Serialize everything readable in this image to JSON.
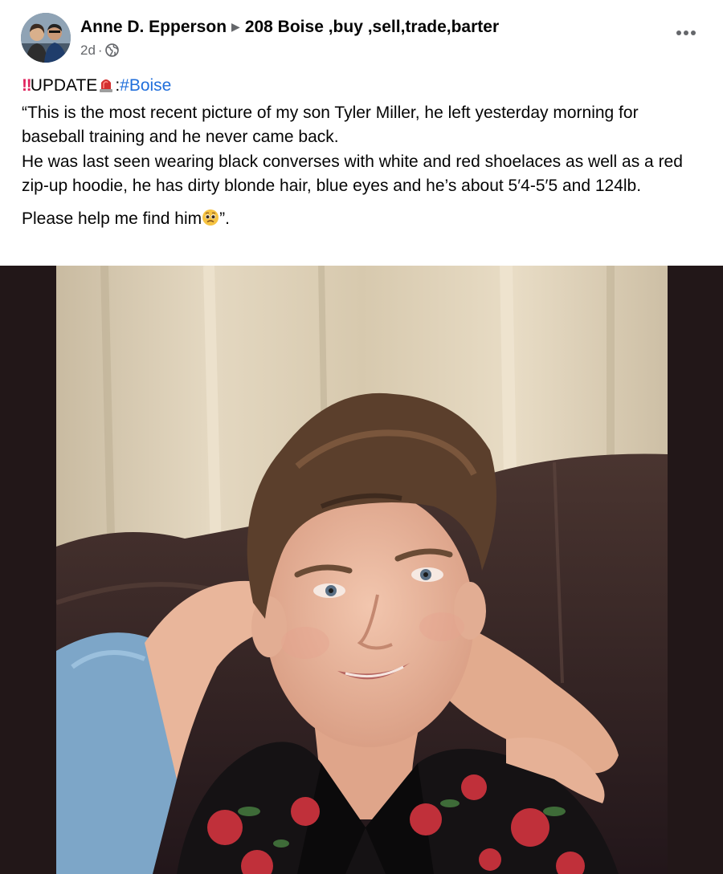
{
  "post": {
    "author": "Anne D. Epperson",
    "group": "208 Boise ,buy ,sell,trade,barter",
    "time": "2d",
    "separator": "·",
    "audience_icon": "globe-icon",
    "more_icon": "more-options-icon",
    "content": {
      "update_label": "UPDATE",
      "hashtag_prefix": ":",
      "hashtag": "#Boise",
      "line1": "“This is the most recent picture of my son Tyler Miller, he left yesterday morning for baseball training and he never came back.",
      "line2": "He was last seen wearing black converses with white and red shoelaces as well as a red zip-up hoodie, he has dirty blonde hair, blue eyes and he’s about 5′4-5′5 and 124lb.",
      "line3": "Please help me find him",
      "line3_end": "”."
    },
    "photo_alt": "Teenage boy in floral shirt sitting on a brown leather couch"
  },
  "colors": {
    "text": "#050505",
    "meta": "#65676b",
    "link": "#216fdb",
    "photo_border": "#221718"
  }
}
